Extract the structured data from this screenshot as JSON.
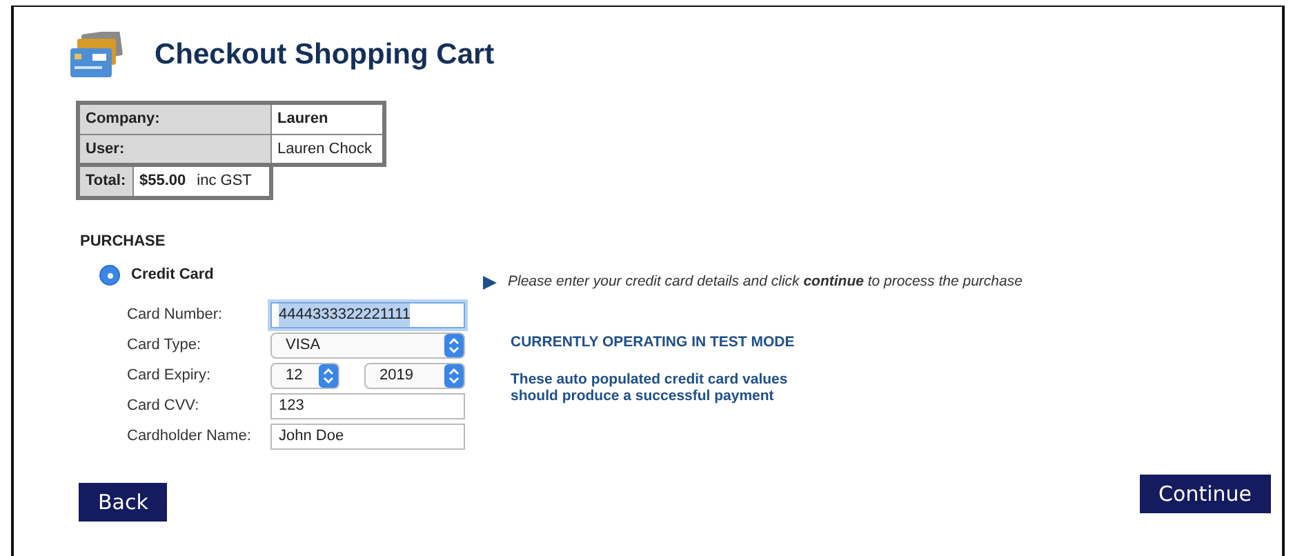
{
  "header": {
    "title": "Checkout Shopping Cart"
  },
  "summary": {
    "rows": [
      {
        "label": "Company:",
        "value": "Lauren",
        "bold": true
      },
      {
        "label": "User:",
        "value": "Lauren Chock",
        "bold": false
      }
    ],
    "total": {
      "label": "Total:",
      "amount": "$55.00",
      "note": "inc GST"
    }
  },
  "purchase": {
    "heading": "PURCHASE",
    "method": {
      "label": "Credit Card",
      "selected": true
    },
    "fields": [
      {
        "kind": "text",
        "label": "Card Number:",
        "value": "4444333322221111",
        "focused": true
      },
      {
        "kind": "select",
        "label": "Card Type:",
        "value": "VISA"
      },
      {
        "kind": "pair",
        "label": "Card Expiry:",
        "values": [
          "12",
          "2019"
        ]
      },
      {
        "kind": "text",
        "label": "Card CVV:",
        "value": "123",
        "focused": false
      },
      {
        "kind": "text",
        "label": "Cardholder Name:",
        "value": "John Doe",
        "focused": false
      }
    ]
  },
  "info": {
    "instruction": "Please enter your credit card details and click **continue** to process the purchase",
    "mode": "CURRENTLY OPERATING IN TEST MODE",
    "note": [
      "These auto populated credit card values",
      "should produce a successful payment"
    ]
  },
  "buttons": [
    {
      "label": "Back"
    },
    {
      "label": "Continue"
    }
  ]
}
